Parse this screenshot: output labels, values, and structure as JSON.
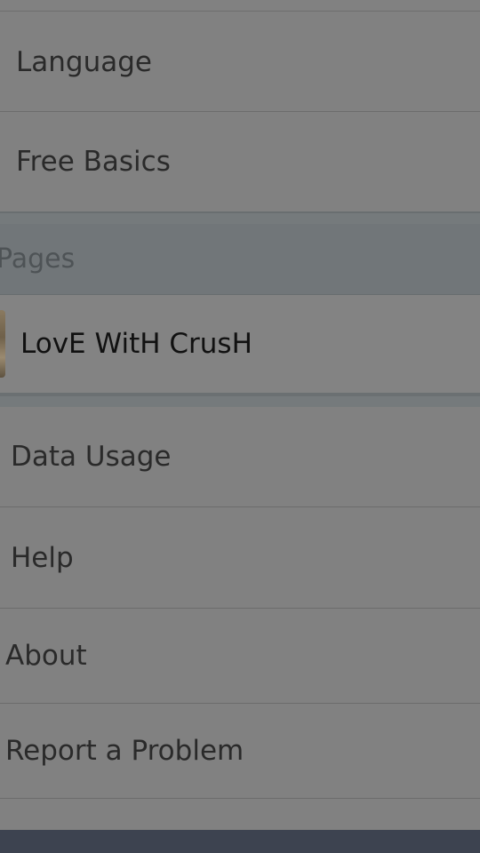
{
  "menu": {
    "items_top": [
      {
        "label": "Language"
      },
      {
        "label": "Free Basics"
      }
    ],
    "pages_section": {
      "header": "Pages",
      "items": [
        {
          "label": "LovE WitH CrusH",
          "avatar_icon": "page-avatar-thumbnail"
        }
      ]
    },
    "items_bottom": [
      {
        "label": "Data Usage"
      },
      {
        "label": "Help"
      },
      {
        "label": "About"
      },
      {
        "label": "Report a Problem"
      }
    ]
  },
  "colors": {
    "overlay_background": "#818181",
    "section_header_background": "#717679",
    "bottom_bar": "#3d4350"
  }
}
